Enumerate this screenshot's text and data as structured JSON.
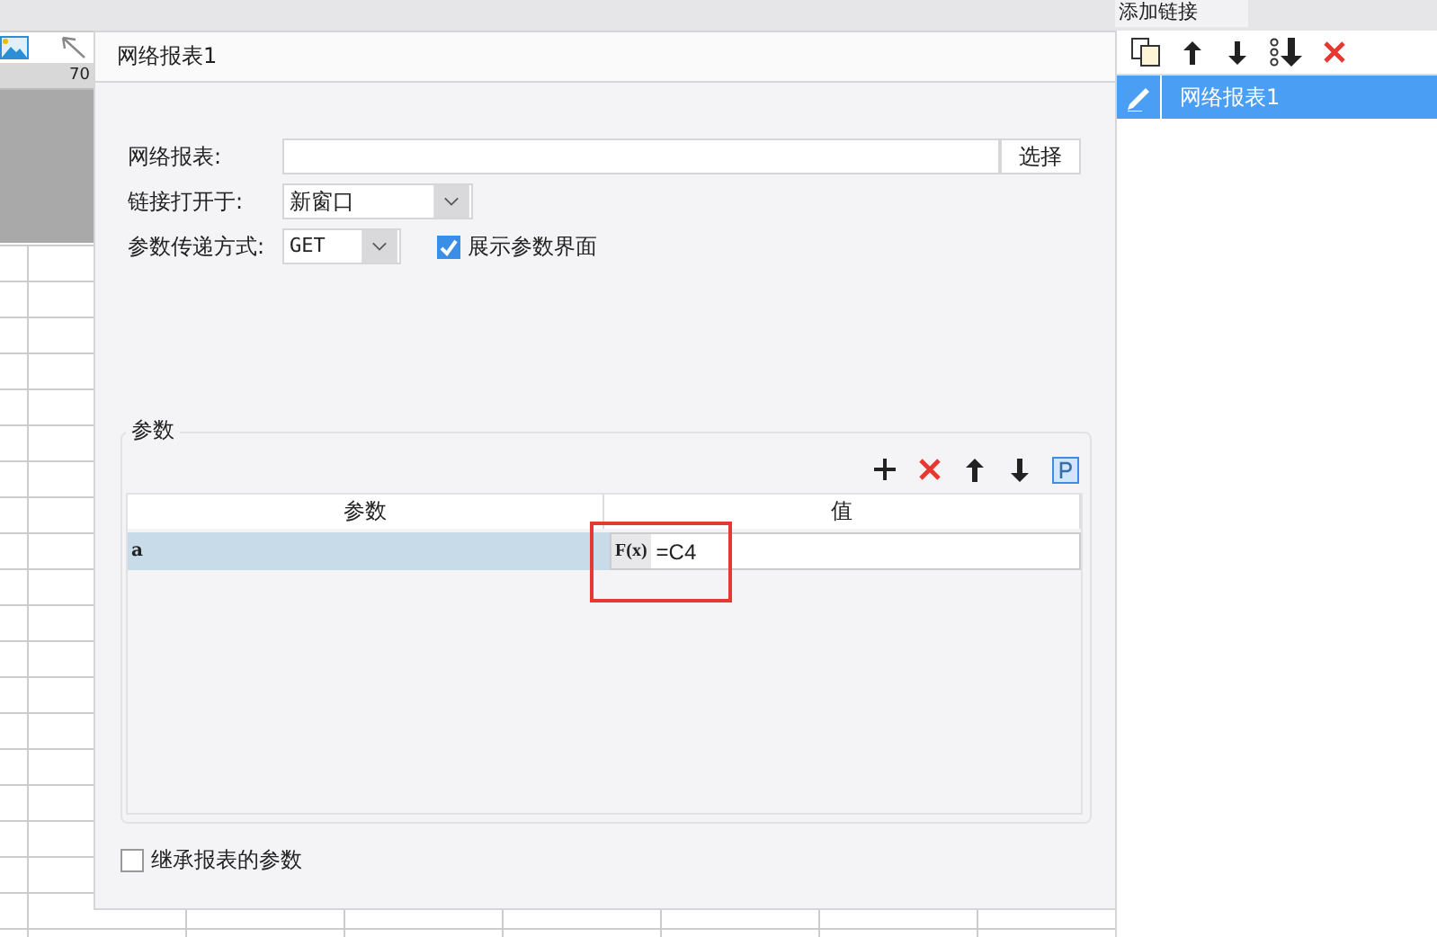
{
  "top_tab": {
    "label": "添加链接"
  },
  "ruler": {
    "label": "70"
  },
  "dialog": {
    "title": "网络报表1",
    "report": {
      "label": "网络报表:",
      "button": "选择"
    },
    "link_target": {
      "label": "链接打开于:",
      "value": "新窗口"
    },
    "method": {
      "label": "参数传递方式:",
      "value": "GET"
    },
    "show_params": {
      "label": "展示参数界面",
      "checked": true
    },
    "params": {
      "title": "参数",
      "columns": [
        "参数",
        "值"
      ],
      "rows": [
        {
          "name": "a",
          "formula_button": "F(x)",
          "value": "=C4",
          "selected": true,
          "highlighted": true
        }
      ]
    },
    "inherit": {
      "label": "继承报表的参数",
      "checked": false
    }
  },
  "links": {
    "items": [
      {
        "label": "网络报表1",
        "selected": true
      }
    ]
  }
}
